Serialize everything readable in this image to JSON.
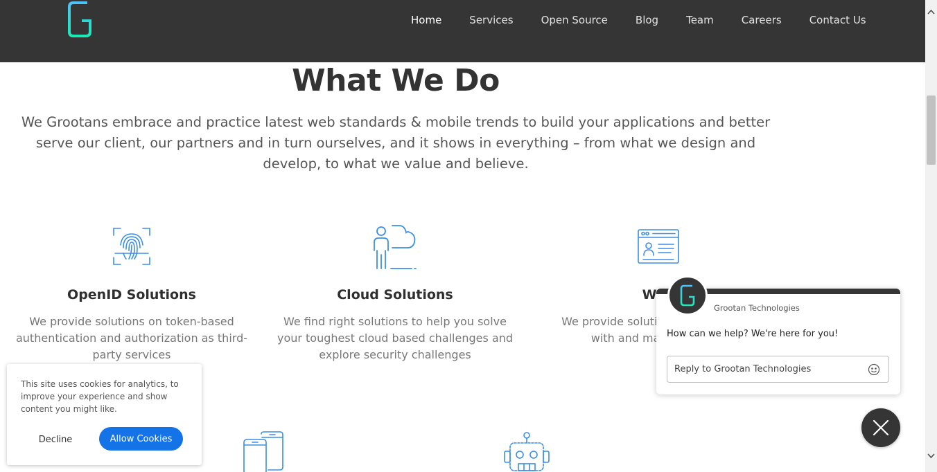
{
  "nav": {
    "items": [
      {
        "label": "Home",
        "active": true
      },
      {
        "label": "Services"
      },
      {
        "label": "Open Source"
      },
      {
        "label": "Blog"
      },
      {
        "label": "Team"
      },
      {
        "label": "Careers"
      },
      {
        "label": "Contact Us"
      }
    ]
  },
  "logo": {
    "icon": "grootan-g-logo"
  },
  "section": {
    "title": "What We Do",
    "intro": "We Grootans embrace and practice latest web standards & mobile trends to build your applications and better serve our client, our partners and in turn ourselves, and it shows in everything – from what we design and develop, to what we value and believe."
  },
  "cards": [
    {
      "icon": "fingerprint-icon",
      "title": "OpenID Solutions",
      "desc": "We provide solutions on token-based authentication and authorization as third-party services"
    },
    {
      "icon": "cloud-person-icon",
      "title": "Cloud Solutions",
      "desc": "We find right solutions to help you solve your toughest cloud based challenges and explore security challenges"
    },
    {
      "icon": "web-profile-icon",
      "title": "Web",
      "desc": "We provide soluti authentication with and make your p"
    }
  ],
  "lower_icons": [
    "mobile-devices-icon",
    "robot-icon"
  ],
  "cookie": {
    "text": "This site uses cookies for analytics, to improve your experience and show content you might like.",
    "decline": "Decline",
    "allow": "Allow Cookies",
    "allow_color": "#1473e6"
  },
  "chat": {
    "company": "Grootan Technologies",
    "message": "How can we help? We're here for you!",
    "placeholder": "Reply to Grootan Technologies",
    "brand_dark": "#353535"
  },
  "colors": {
    "header": "#353535",
    "icon_blue": "#3a8ee6",
    "logo_gradient_start": "#4fc3f7",
    "logo_gradient_end": "#1e88e5"
  }
}
